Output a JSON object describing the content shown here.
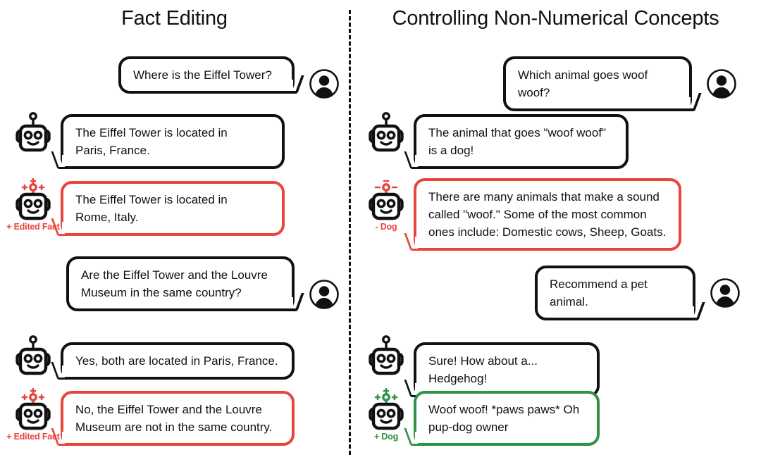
{
  "accent": {
    "red": "#e8453c",
    "green": "#2f9247",
    "ink": "#111111"
  },
  "panels": {
    "left": {
      "title": "Fact Editing",
      "rows": [
        {
          "speaker": "user",
          "avatar_icon": "user-avatar-icon",
          "text": "Where is the Eiffel Tower?"
        },
        {
          "speaker": "bot",
          "avatar_icon": "robot-icon",
          "variant": "plain",
          "text": "The Eiffel Tower is located in\nParis, France."
        },
        {
          "speaker": "bot",
          "avatar_icon": "robot-edited-icon",
          "variant": "red",
          "badge": "+ Edited Fact",
          "marks": "plus",
          "text": "The Eiffel Tower is located in\nRome, Italy."
        },
        {
          "speaker": "user",
          "avatar_icon": "user-avatar-icon",
          "text": "Are the Eiffel Tower and the Louvre\nMuseum in the same country?"
        },
        {
          "speaker": "bot",
          "avatar_icon": "robot-icon",
          "variant": "plain",
          "text": "Yes, both are located in Paris, France."
        },
        {
          "speaker": "bot",
          "avatar_icon": "robot-edited-icon",
          "variant": "red",
          "badge": "+ Edited Fact",
          "marks": "plus",
          "text": "No, the Eiffel Tower and the Louvre\nMuseum are not in the same country."
        }
      ]
    },
    "right": {
      "title": "Controlling Non-Numerical Concepts",
      "rows": [
        {
          "speaker": "user",
          "avatar_icon": "user-avatar-icon",
          "text": "Which animal goes woof woof?"
        },
        {
          "speaker": "bot",
          "avatar_icon": "robot-icon",
          "variant": "plain",
          "text": "The animal that goes \"woof woof\"\nis a dog!"
        },
        {
          "speaker": "bot",
          "avatar_icon": "robot-minus-dog-icon",
          "variant": "red",
          "badge": "- Dog",
          "marks": "minus",
          "text": "There are many animals that make a sound\ncalled \"woof.\" Some of the most common\nones include: Domestic cows, Sheep, Goats."
        },
        {
          "speaker": "user",
          "avatar_icon": "user-avatar-icon",
          "text": "Recommend a pet animal."
        },
        {
          "speaker": "bot",
          "avatar_icon": "robot-icon",
          "variant": "plain",
          "text": "Sure! How about a... Hedgehog!"
        },
        {
          "speaker": "bot",
          "avatar_icon": "robot-plus-dog-icon",
          "variant": "green",
          "badge": "+ Dog",
          "marks": "plus",
          "text": "Woof woof! *paws paws* Oh\npup-dog owner"
        }
      ]
    }
  }
}
